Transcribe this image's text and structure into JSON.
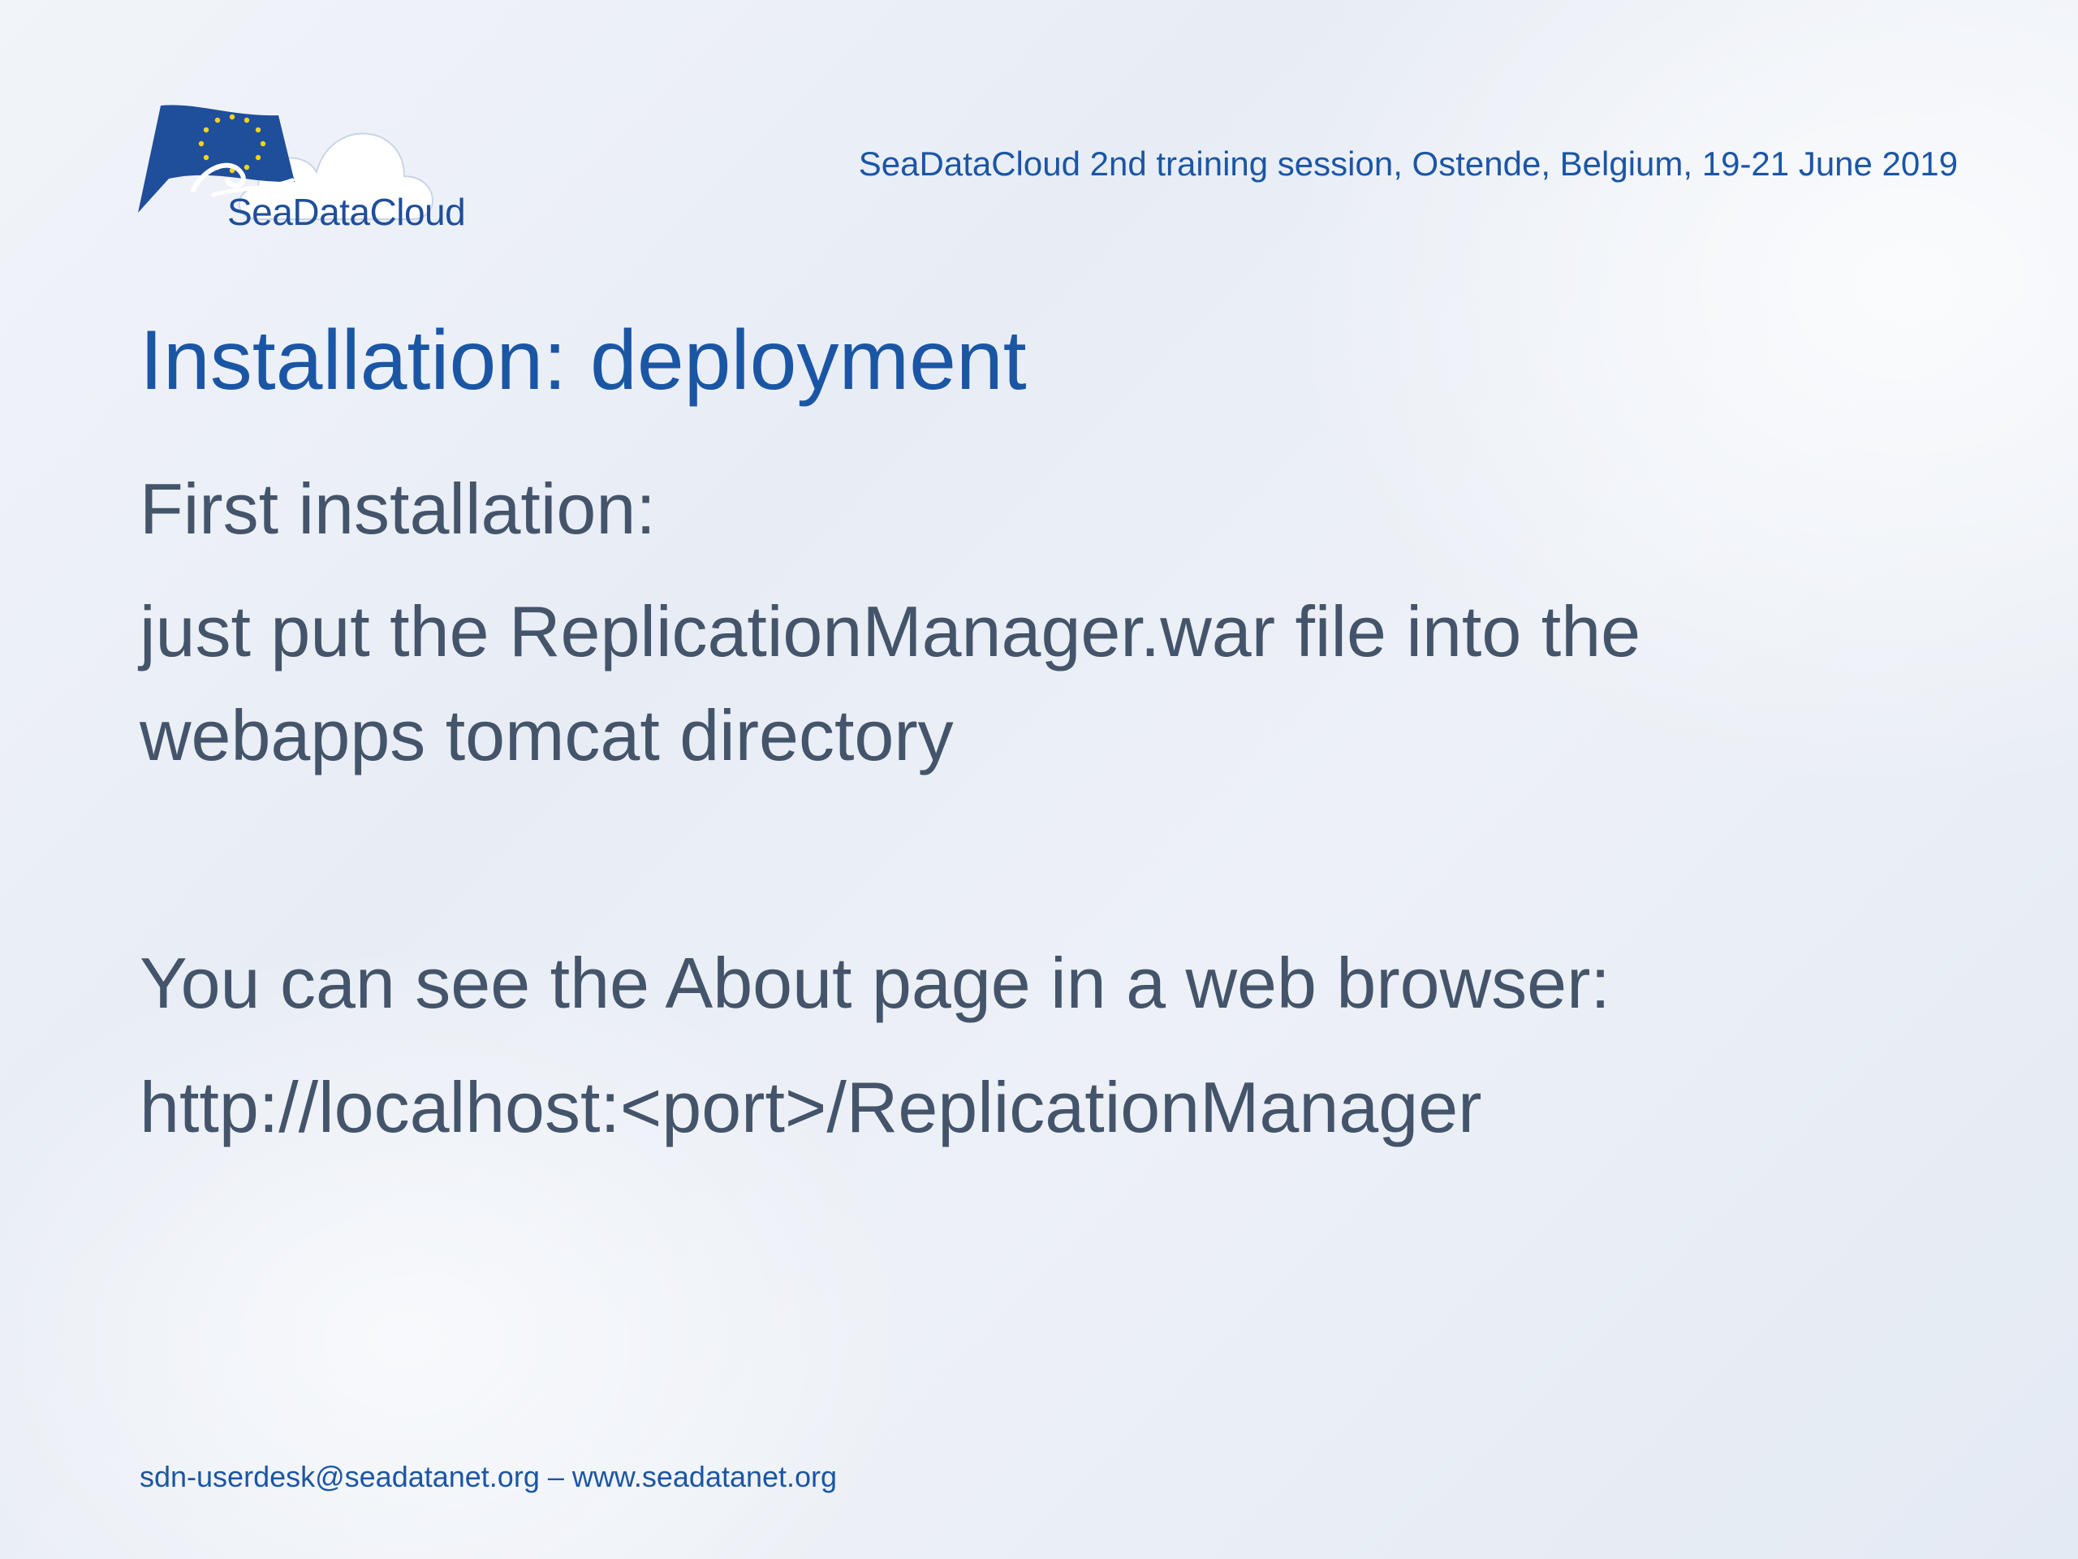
{
  "logo": {
    "text": "SeaDataCloud",
    "colors": {
      "flag": "#1f4e9b",
      "stars": "#f5d31a",
      "cloud": "#ffffff"
    }
  },
  "header": {
    "event": "SeaDataCloud 2nd training session, Ostende, Belgium, 19-21 June 2019"
  },
  "slide": {
    "title": "Installation: deployment",
    "lines": [
      "First installation:",
      "just put the ReplicationManager.war file into the",
      "webapps tomcat directory",
      "You can see the About page in a web browser:",
      "http://localhost:<port>/ReplicationManager"
    ]
  },
  "footer": {
    "contact": "sdn-userdesk@seadatanet.org – www.seadatanet.org"
  },
  "colors": {
    "title": "#1b56a5",
    "body": "#44546a",
    "background": "#eaeff6"
  }
}
